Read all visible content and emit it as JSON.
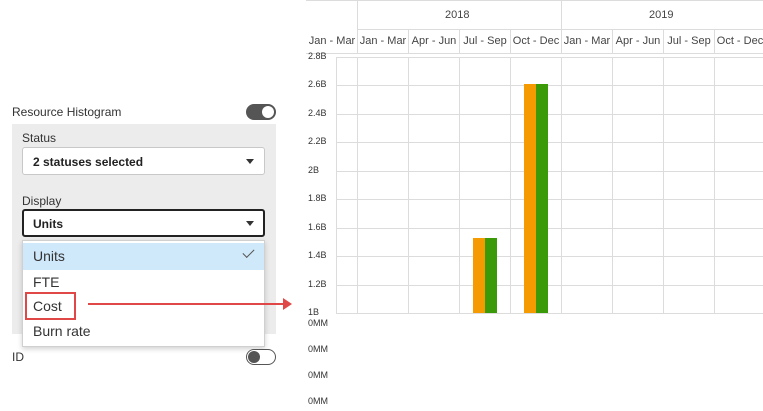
{
  "panel": {
    "resource_histogram_label": "Resource Histogram",
    "resource_histogram_on": true,
    "status_label": "Status",
    "status_value": "2 statuses selected",
    "display_label": "Display",
    "display_value": "Units",
    "display_options": [
      "Units",
      "FTE",
      "Cost",
      "Burn rate"
    ],
    "display_selected_index": 0,
    "id_label": "ID",
    "id_on": false
  },
  "annotation": {
    "highlighted_option": "Cost",
    "color": "#e04848"
  },
  "timeline": {
    "years": [
      "2018",
      "2019"
    ],
    "quarters": [
      "Jan - Mar",
      "Jan - Mar",
      "Apr - Jun",
      "Jul - Sep",
      "Oct - Dec",
      "Jan - Mar",
      "Apr - Jun",
      "Jul - Sep",
      "Oct - Dec"
    ]
  },
  "chart_data": {
    "type": "bar",
    "categories": [
      "Jan - Mar",
      "Jan - Mar",
      "Apr - Jun",
      "Jul - Sep",
      "Oct - Dec",
      "Jan - Mar",
      "Apr - Jun",
      "Jul - Sep",
      "Oct - Dec"
    ],
    "y_ticks": [
      "2.8B",
      "2.6B",
      "2.4B",
      "2.2B",
      "2B",
      "1.8B",
      "1.6B",
      "1.4B",
      "1.2B",
      "1B",
      "0MM",
      "0MM",
      "0MM",
      "0MM"
    ],
    "series": [
      {
        "color": "#f59a00",
        "values": [
          0,
          0,
          0,
          1.53,
          2.61,
          0,
          0,
          0,
          0
        ]
      },
      {
        "color": "#3a9a08",
        "values": [
          0,
          0,
          0,
          1.53,
          2.61,
          0,
          0,
          0,
          0
        ]
      }
    ],
    "ylim": [
      1.0,
      2.8
    ]
  }
}
